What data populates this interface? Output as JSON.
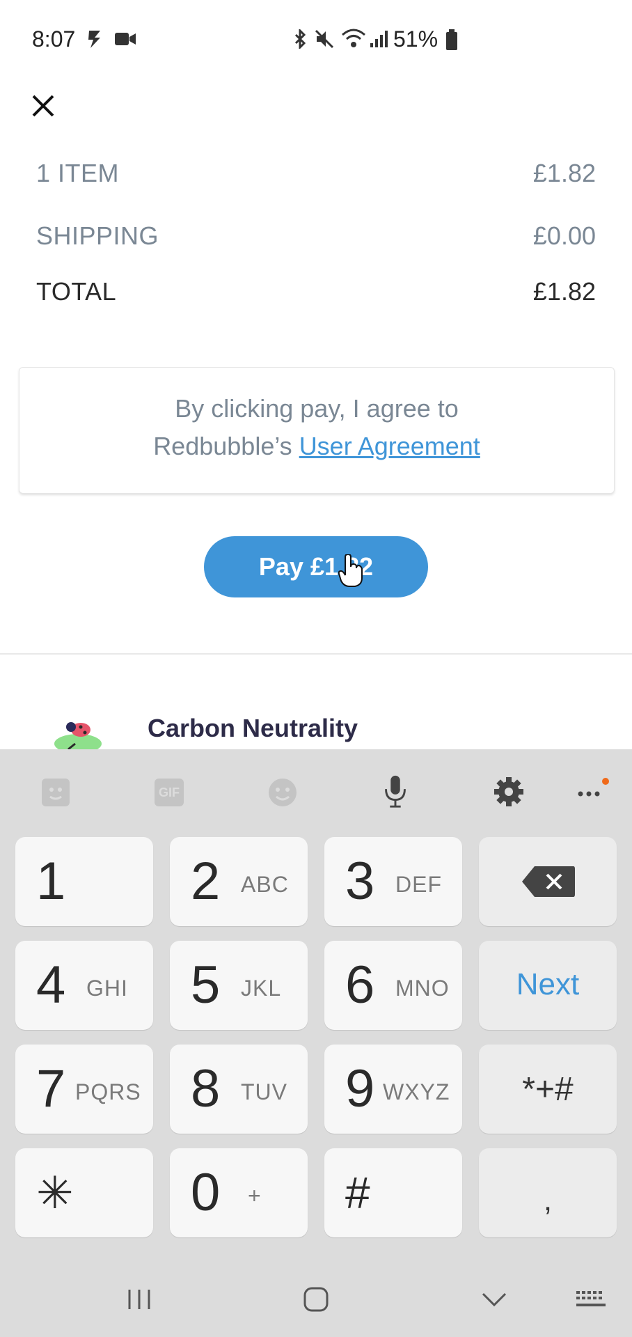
{
  "status_bar": {
    "time": "8:07",
    "battery": "51%"
  },
  "summary": {
    "rows": [
      {
        "label": "1 ITEM",
        "value": "£1.82"
      },
      {
        "label": "SHIPPING",
        "value": "£0.00"
      },
      {
        "label": "TOTAL",
        "value": "£1.82"
      }
    ]
  },
  "agreement": {
    "line1": "By clicking pay, I agree to",
    "prefix": "Redbubble’s ",
    "link": "User Agreement"
  },
  "pay_button": {
    "label": "Pay £1.82"
  },
  "carbon": {
    "title": "Carbon Neutrality"
  },
  "keyboard": {
    "keys": [
      {
        "digit": "1",
        "letters": ""
      },
      {
        "digit": "2",
        "letters": "ABC"
      },
      {
        "digit": "3",
        "letters": "DEF"
      },
      {
        "digit": "4",
        "letters": "GHI"
      },
      {
        "digit": "5",
        "letters": "JKL"
      },
      {
        "digit": "6",
        "letters": "MNO"
      },
      {
        "digit": "7",
        "letters": "PQRS"
      },
      {
        "digit": "8",
        "letters": "TUV"
      },
      {
        "digit": "9",
        "letters": "WXYZ"
      },
      {
        "digit": "✳",
        "letters": ""
      },
      {
        "digit": "0",
        "letters": "+"
      },
      {
        "digit": "#",
        "letters": ""
      }
    ],
    "next_label": "Next",
    "symbols_label": "*+#",
    "comma_label": ",",
    "gif_label": "GIF",
    "accent_color": "#3f95d8"
  }
}
